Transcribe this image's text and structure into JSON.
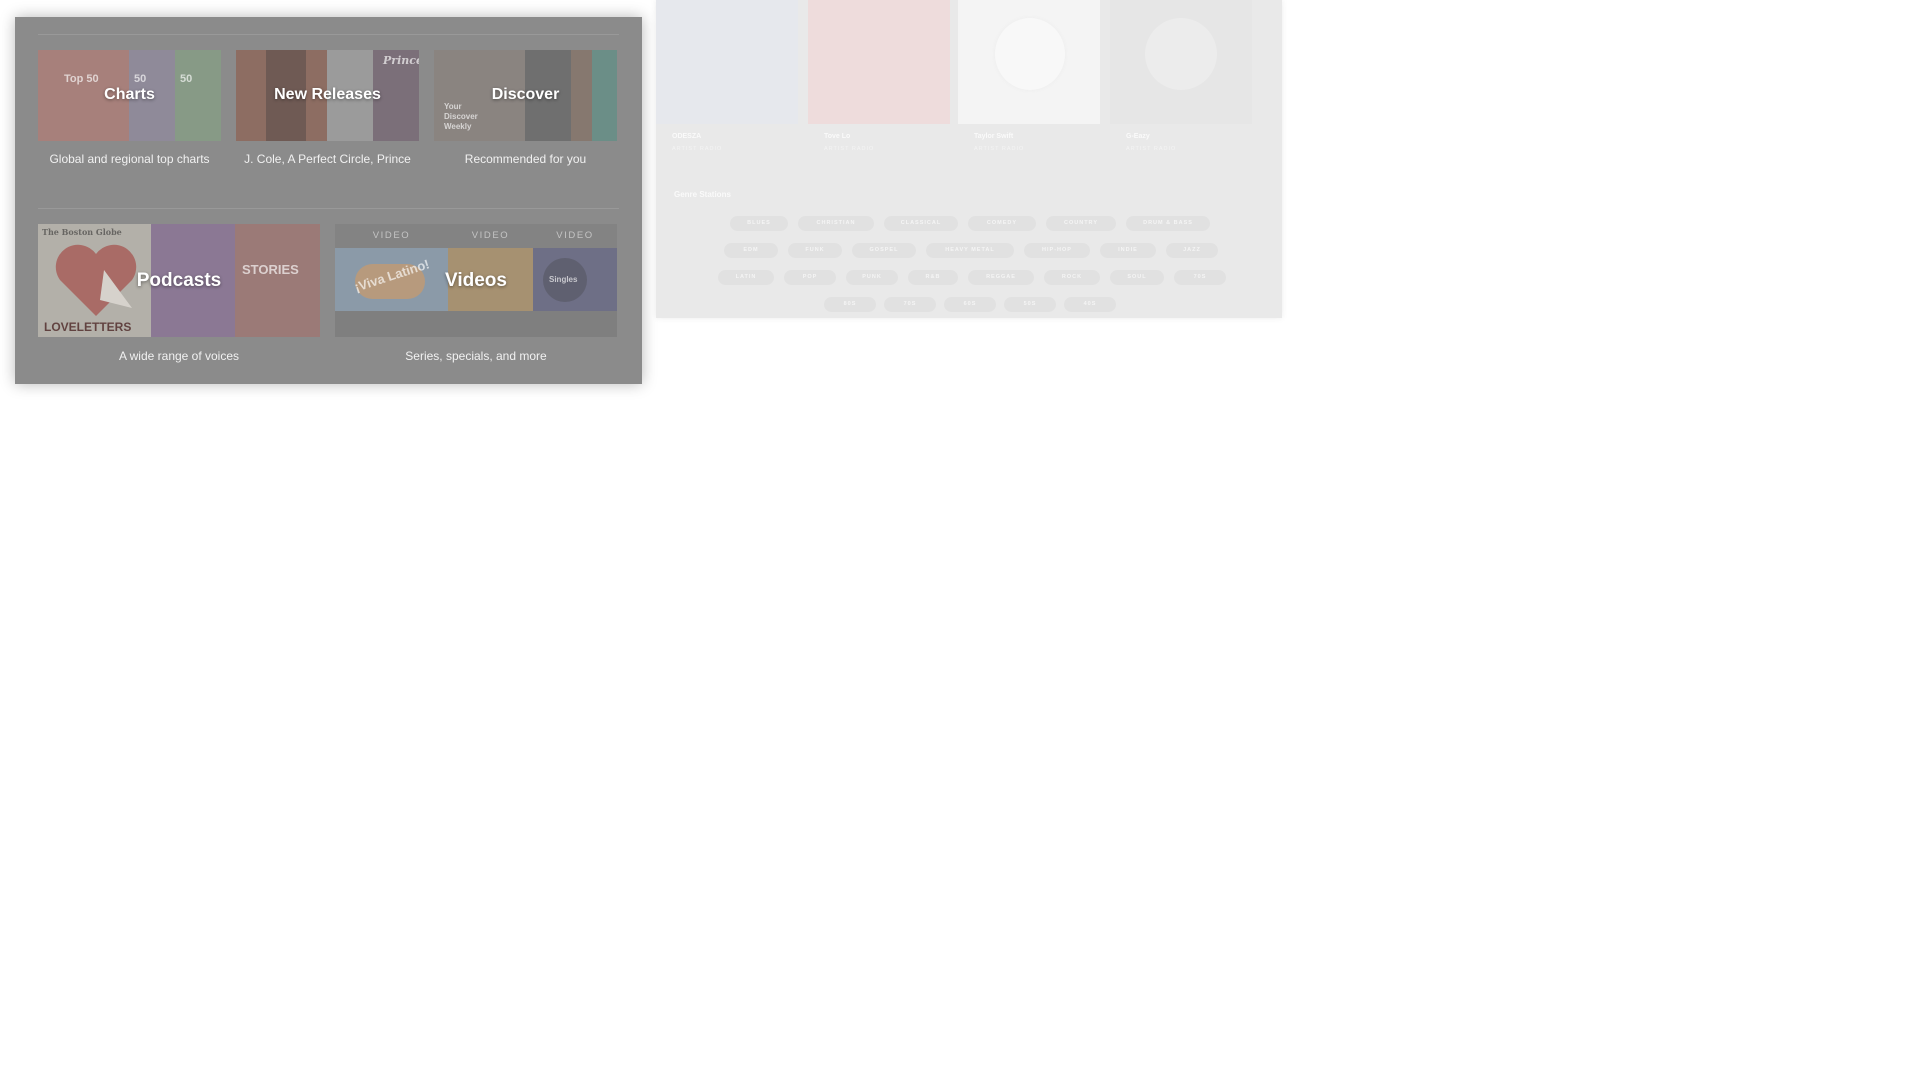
{
  "browse": {
    "tiles": [
      {
        "title": "Charts",
        "subtitle": "Global and regional top charts",
        "art": [
          "Top 50",
          "50",
          "50"
        ]
      },
      {
        "title": "New Releases",
        "subtitle": "J. Cole, A Perfect Circle, Prince",
        "art": [
          "Prince"
        ]
      },
      {
        "title": "Discover",
        "subtitle": "Recommended for you",
        "art": [
          "Your Discover Weekly"
        ]
      },
      {
        "title": "Podcasts",
        "subtitle": "A wide range of voices",
        "art": [
          "The Boston Globe",
          "LOVELETTERS",
          "STORIES"
        ]
      },
      {
        "title": "Videos",
        "subtitle": "Series, specials, and more",
        "art": [
          "¡Viva Latino!",
          "Singles"
        ],
        "video_badges": [
          "VIDEO",
          "VIDEO",
          "VIDEO"
        ]
      }
    ]
  },
  "radio": {
    "artists": [
      {
        "name": "ODESZA",
        "type": "ARTIST RADIO"
      },
      {
        "name": "Tove Lo",
        "type": "ARTIST RADIO"
      },
      {
        "name": "Taylor Swift",
        "type": "ARTIST RADIO"
      },
      {
        "name": "G-Eazy",
        "type": "ARTIST RADIO"
      }
    ],
    "genre_title": "Genre Stations",
    "genres": [
      [
        "BLUES",
        "CHRISTIAN",
        "CLASSICAL",
        "COMEDY",
        "COUNTRY",
        "DRUM & BASS"
      ],
      [
        "EDM",
        "FUNK",
        "GOSPEL",
        "HEAVY METAL",
        "HIP-HOP",
        "INDIE",
        "JAZZ"
      ],
      [
        "LATIN",
        "POP",
        "PUNK",
        "R&B",
        "REGGAE",
        "ROCK",
        "SOUL",
        "70S"
      ],
      [
        "80S",
        "70S",
        "60S",
        "50S",
        "40S"
      ]
    ]
  }
}
